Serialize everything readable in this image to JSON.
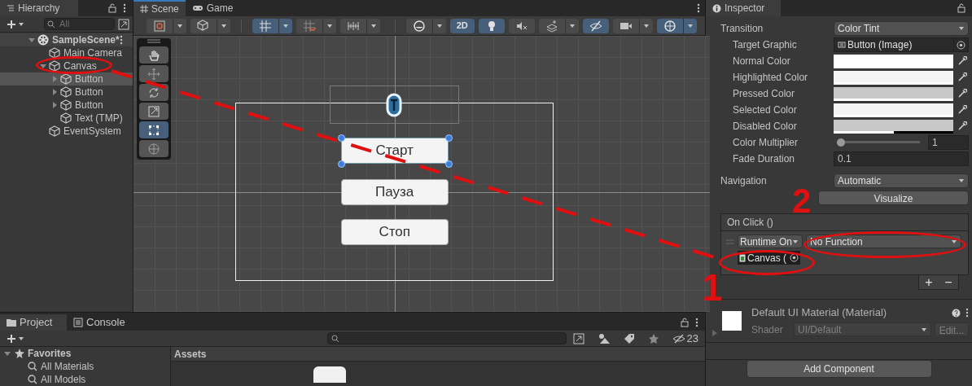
{
  "hierarchy": {
    "title": "Hierarchy",
    "search": {
      "placeholder": "All"
    },
    "tree": [
      {
        "label": "SampleScene*",
        "kind": "scene",
        "expanded": true,
        "selected": false,
        "children": [
          {
            "label": "Main Camera",
            "kind": "object",
            "selected": false
          },
          {
            "label": "Canvas",
            "kind": "object",
            "expanded": true,
            "selected": false,
            "children": [
              {
                "label": "Button",
                "kind": "object",
                "expanded": false,
                "selected": true
              },
              {
                "label": "Button",
                "kind": "object",
                "expanded": false,
                "selected": false
              },
              {
                "label": "Button",
                "kind": "object",
                "expanded": false,
                "selected": false
              },
              {
                "label": "Text (TMP)",
                "kind": "object",
                "selected": false
              }
            ]
          },
          {
            "label": "EventSystem",
            "kind": "object",
            "selected": false
          }
        ]
      }
    ]
  },
  "scene": {
    "tabs": [
      {
        "label": "Scene",
        "kind": "scene",
        "selected": true
      },
      {
        "label": "Game",
        "kind": "game",
        "selected": false
      }
    ],
    "toolbar": [
      {
        "kind": "draw",
        "on": false,
        "menu": true
      },
      {
        "kind": "cube",
        "on": false,
        "menu": true
      },
      {
        "kind": "grid",
        "on": true,
        "menu": true
      },
      {
        "kind": "snap",
        "on": false,
        "menu": true
      },
      {
        "kind": "ruler",
        "on": false,
        "menu": true
      },
      {
        "kind": "shading",
        "on": false,
        "menu": true
      },
      {
        "kind": "label",
        "label": "2D",
        "on": true,
        "menu": false
      },
      {
        "kind": "light",
        "on": true,
        "menu": false
      },
      {
        "kind": "audio",
        "on": false,
        "menu": false
      },
      {
        "kind": "effects",
        "on": false,
        "menu": true
      },
      {
        "kind": "hidden",
        "on": true,
        "menu": false
      },
      {
        "kind": "camera",
        "on": false,
        "menu": true
      },
      {
        "kind": "gizmos",
        "on": true,
        "menu": true
      }
    ],
    "tools": [
      {
        "kind": "hand",
        "selected": false
      },
      {
        "kind": "move",
        "selected": false
      },
      {
        "kind": "rotate",
        "selected": false
      },
      {
        "kind": "scale",
        "selected": false
      },
      {
        "kind": "rect",
        "selected": true
      },
      {
        "kind": "transform",
        "selected": false
      }
    ],
    "buttons": [
      {
        "label": "Старт",
        "selected": true
      },
      {
        "label": "Пауза",
        "selected": false
      },
      {
        "label": "Стоп",
        "selected": false
      }
    ]
  },
  "project": {
    "tabs": [
      {
        "label": "Project",
        "kind": "folder",
        "selected": true
      },
      {
        "label": "Console",
        "kind": "console",
        "selected": false
      }
    ],
    "hidden_count": "23",
    "favorites": {
      "label": "Favorites",
      "items": [
        "All Materials",
        "All Models"
      ]
    },
    "assets_title": "Assets"
  },
  "inspector": {
    "title": "Inspector",
    "properties": [
      {
        "label": "Transition",
        "kind": "dropdown",
        "value": "Color Tint",
        "children": [
          {
            "label": "Target Graphic",
            "kind": "object",
            "value": "Button (Image)"
          },
          {
            "label": "Normal Color",
            "kind": "color",
            "color": "#ffffff",
            "level": 1
          },
          {
            "label": "Highlighted Color",
            "kind": "color",
            "color": "#f5f5f5",
            "level": 1
          },
          {
            "label": "Pressed Color",
            "kind": "color",
            "color": "#c8c8c8",
            "level": 1
          },
          {
            "label": "Selected Color",
            "kind": "color",
            "color": "#f5f5f5",
            "level": 1
          },
          {
            "label": "Disabled Color",
            "kind": "color",
            "color": "#c8c8c8",
            "level": 0.5
          },
          {
            "label": "Color Multiplier",
            "kind": "slider",
            "level": 0,
            "value": "1"
          },
          {
            "label": "Fade Duration",
            "kind": "field",
            "value": "0.1"
          }
        ]
      },
      {
        "label": "Navigation",
        "kind": "dropdown",
        "value": "Automatic"
      },
      {
        "label": "Visualize",
        "kind": "button"
      }
    ],
    "on_click": {
      "title": "On Click ()",
      "entries": [
        {
          "mode": "Runtime On",
          "function": "No Function",
          "target": "Canvas ("
        }
      ],
      "add": "+",
      "remove": "−"
    },
    "material": {
      "name": "Default UI Material (Material)",
      "shader_label": "Shader",
      "shader": "UI/Default",
      "edit": "Edit..."
    },
    "add_component": "Add Component"
  },
  "annotations": [
    "1",
    "2"
  ]
}
